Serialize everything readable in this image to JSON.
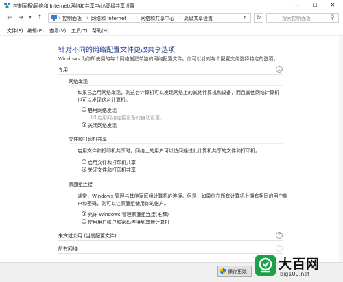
{
  "window": {
    "title": "控制面板\\网络和 Internet\\网络和共享中心\\高级共享设置",
    "minimize": "—",
    "maximize": "☐",
    "close": "✕"
  },
  "address": {
    "back": "←",
    "forward": "→",
    "up": "↑",
    "crumbs": [
      "控制面板",
      "网络和 Internet",
      "网络和共享中心",
      "高级共享设置"
    ],
    "separator": "›",
    "refresh": "↻",
    "search_placeholder": "搜索控制面板"
  },
  "menu": [
    "文件(F)",
    "编辑(E)",
    "查看(V)",
    "工具(T)",
    "帮助(H)"
  ],
  "page": {
    "heading": "针对不同的网络配置文件更改共享选项",
    "description": "Windows 为你所使用的每个网络创建单独的网络配置文件。你可以针对每个配置文件选择特定的选项。"
  },
  "private": {
    "label": "专用",
    "chevron": "︿",
    "discovery": {
      "title": "网络发现",
      "text1": "如果已启用网络发现，则这台计算机可以发现网络上的其他计算机和设备，而且其他网络计算机",
      "text2": "也可以发现这台计算机。",
      "opt_on": "启用网络发现",
      "opt_auto": "启用网络连接设备的自动设置。",
      "opt_off": "关闭网络发现"
    },
    "fileshare": {
      "title": "文件和打印机共享",
      "text": "启用文件和打印机共享时，网络上的用户可以访问通过此计算机共享的文件和打印机。",
      "opt_on": "启用文件和打印机共享",
      "opt_off": "关闭文件和打印机共享"
    },
    "homegroup": {
      "title": "家庭组连接",
      "text1": "通常，Windows 管理与其他家庭组计算机的连接。但是，如果你在所有计算机上拥有相同的用户帐",
      "text2": "户和密码，则可以让家庭组使用你的帐户。",
      "opt_windows": "允许 Windows 管理家庭组连接(推荐)",
      "opt_user": "使用用户帐户和密码连接到其他计算机"
    }
  },
  "guest": {
    "label": "来宾或公用 (当前配置文件)",
    "chevron": "﹀"
  },
  "allnet": {
    "label": "所有网络",
    "chevron": "﹀"
  },
  "footer": {
    "save": "保存更改"
  },
  "watermark": {
    "big": "大百网",
    "small": "big100.net",
    "accent": "#1aa14a"
  },
  "colors": {
    "heading": "#1e3a8a"
  }
}
